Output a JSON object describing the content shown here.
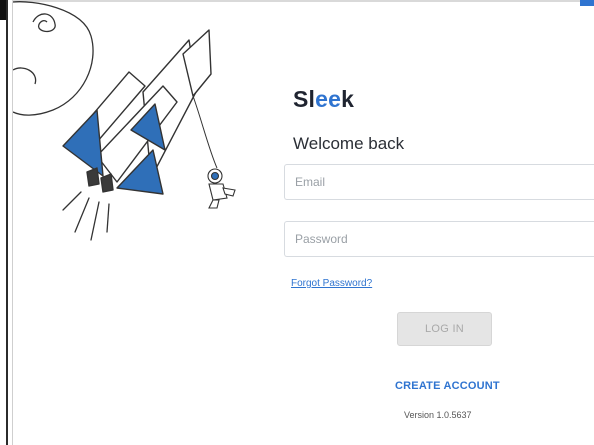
{
  "brand": {
    "logo_part1": "Sl",
    "logo_accent": "ee",
    "logo_part2": "k",
    "accent_color": "#2f74d0"
  },
  "login": {
    "welcome": "Welcome back",
    "email_placeholder": "Email",
    "password_placeholder": "Password",
    "forgot_label": "Forgot Password?",
    "login_label": "LOG IN",
    "create_label": "CREATE ACCOUNT",
    "version": "Version 1.0.5637"
  },
  "illustration": {
    "rocket_icon": "rocket-icon",
    "astronaut_icon": "astronaut-icon",
    "planet_icon": "planet-icon"
  }
}
